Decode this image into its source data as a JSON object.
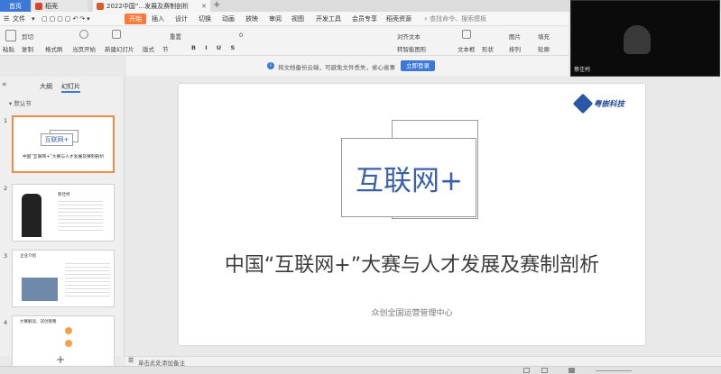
{
  "tabs": [
    {
      "label": "首页"
    },
    {
      "label": "稻壳"
    },
    {
      "label": "2022中国“...发展及赛制剖析"
    }
  ],
  "menu": {
    "file_label": "文件",
    "items": [
      "开始",
      "插入",
      "设计",
      "切换",
      "动画",
      "放映",
      "审阅",
      "视图",
      "开发工具",
      "会员专享",
      "稻壳资源"
    ],
    "active": "开始",
    "search_placeholder": "查找命令、搜索模板"
  },
  "ribbon": {
    "paste": "粘贴",
    "format_painter": "格式刷",
    "cut": "剪切",
    "copy": "复制",
    "from_current": "当页开始",
    "new_slide": "新建幻灯片",
    "layout": "版式",
    "section": "节",
    "reset": "重置",
    "font_size": "0",
    "text_align": "对齐文本",
    "smart_graphic": "转智能图形",
    "textbox": "文本框",
    "shape": "形状",
    "arrange": "排列",
    "picture": "图片",
    "fill": "填充",
    "outline": "轮廓"
  },
  "notice": {
    "icon": "i",
    "text": "将文档备份云端，可避免文件丢失，省心省事",
    "button": "立即登录"
  },
  "camera": {
    "name": "蔡佳柯"
  },
  "left_panel": {
    "tab_outline": "大纲",
    "tab_slides": "幻灯片",
    "section": "默认节",
    "slides": [
      {
        "num": "1",
        "title": "中国“互联网+”大赛与人才发展及赛制剖析",
        "brand": "互联网+"
      },
      {
        "num": "2",
        "title": "蔡佳柯"
      },
      {
        "num": "3",
        "title": "企业介绍"
      },
      {
        "num": "4",
        "title": "大赛解读、双创策略"
      }
    ],
    "add_icon": "+"
  },
  "slide": {
    "logo_text": "粤嵌科技",
    "brand": "互联网+",
    "title": "中国“互联网+”大赛与人才发展及赛制剖析",
    "subtitle": "众创全国运营管理中心"
  },
  "notes": {
    "placeholder": "单击此处添加备注"
  },
  "colors": {
    "accent": "#3b78d8",
    "menu_active": "#ff7a3a",
    "brand_blue": "#3a60a8",
    "selected_thumb": "#f08a47"
  }
}
